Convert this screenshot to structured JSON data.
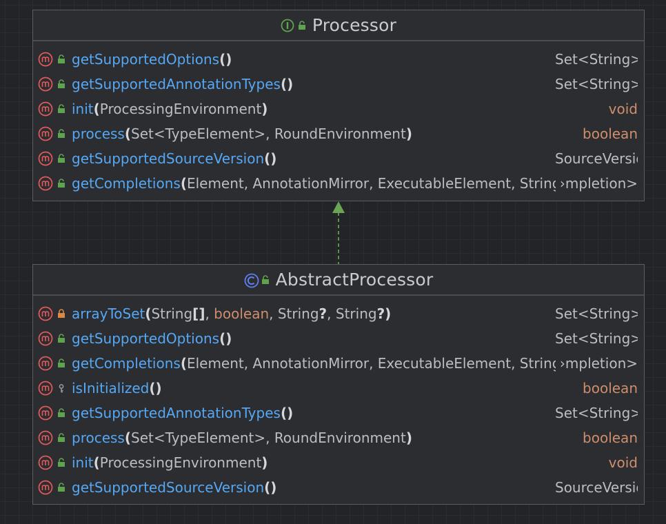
{
  "processor": {
    "title": "Processor",
    "kind_icon": "interface-icon",
    "methods": [
      {
        "name": "getSupportedOptions",
        "open": "(",
        "params": "",
        "close": ")",
        "ret": "Set<String>",
        "ret_kw": false,
        "visibility": "public"
      },
      {
        "name": "getSupportedAnnotationTypes",
        "open": "(",
        "params": "",
        "close": ")",
        "ret": "Set<String>",
        "ret_kw": false,
        "visibility": "public"
      },
      {
        "name": "init",
        "open": "(",
        "params": "ProcessingEnvironment",
        "close": ")",
        "ret": "void",
        "ret_kw": true,
        "visibility": "public"
      },
      {
        "name": "process",
        "open": "(",
        "params": "Set<TypeElement>, RoundEnvironment",
        "close": ")",
        "ret": "boolean",
        "ret_kw": true,
        "visibility": "public"
      },
      {
        "name": "getSupportedSourceVersion",
        "open": "(",
        "params": "",
        "close": ")",
        "ret": "SourceVersion",
        "ret_kw": false,
        "visibility": "public"
      },
      {
        "name": "getCompletions",
        "open": "(",
        "params": "Element, AnnotationMirror, ExecutableElement, String",
        "close": ")",
        "ret": "›mpletion>",
        "ret_kw": false,
        "visibility": "public"
      }
    ]
  },
  "abstract_processor": {
    "title": "AbstractProcessor",
    "kind_icon": "class-icon",
    "methods": [
      {
        "name": "arrayToSet",
        "open": "(",
        "params_html": "arrayToSet",
        "params": "String[], boolean, String?, String?",
        "close": ")",
        "ret": "Set<String>",
        "ret_kw": false,
        "visibility": "private"
      },
      {
        "name": "getSupportedOptions",
        "open": "(",
        "params": "",
        "close": ")",
        "ret": "Set<String>",
        "ret_kw": false,
        "visibility": "public"
      },
      {
        "name": "getCompletions",
        "open": "(",
        "params": "Element, AnnotationMirror, ExecutableElement, String",
        "close": ")",
        "ret": "›mpletion>",
        "ret_kw": false,
        "visibility": "public"
      },
      {
        "name": "isInitialized",
        "open": "(",
        "params": "",
        "close": ")",
        "ret": "boolean",
        "ret_kw": true,
        "visibility": "protected"
      },
      {
        "name": "getSupportedAnnotationTypes",
        "open": "(",
        "params": "",
        "close": ")",
        "ret": "Set<String>",
        "ret_kw": false,
        "visibility": "public"
      },
      {
        "name": "process",
        "open": "(",
        "params": "Set<TypeElement>, RoundEnvironment",
        "close": ")",
        "ret": "boolean",
        "ret_kw": true,
        "visibility": "public"
      },
      {
        "name": "init",
        "open": "(",
        "params": "ProcessingEnvironment",
        "close": ")",
        "ret": "void",
        "ret_kw": true,
        "visibility": "public"
      },
      {
        "name": "getSupportedSourceVersion",
        "open": "(",
        "params": "",
        "close": ")",
        "ret": "SourceVersion",
        "ret_kw": false,
        "visibility": "public"
      }
    ]
  },
  "relation": {
    "type": "implements",
    "from": "AbstractProcessor",
    "to": "Processor",
    "color": "#5f8f4e"
  },
  "colors": {
    "method_name": "#56a8f5",
    "keyword": "#cf8e6d",
    "text": "#bcbec4",
    "method_icon": "#e55b5b",
    "public_icon": "#5ea44f",
    "private_icon": "#d98845"
  }
}
